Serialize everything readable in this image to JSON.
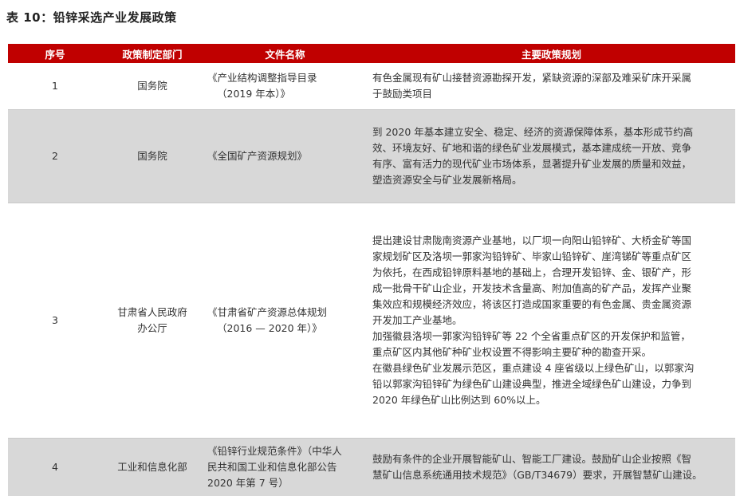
{
  "title": "表 10：铅锌采选产业发展政策",
  "headers": [
    "序号",
    "政策制定部门",
    "文件名称",
    "主要政策规划"
  ],
  "rows": [
    {
      "no": "1",
      "dept": "国务院",
      "doc": [
        "《产业结构调整指导目录",
        "（2019 年本）》"
      ],
      "plan": [
        "有色金属现有矿山接替资源勘探开发，紧缺资源的深部及难采矿床开采属",
        "于鼓励类项目"
      ]
    },
    {
      "no": "2",
      "dept": "国务院",
      "doc": [
        "《全国矿产资源规划》"
      ],
      "plan": [
        "到 2020 年基本建立安全、稳定、经济的资源保障体系，基本形成节约高",
        "效、环境友好、矿地和谐的绿色矿业发展模式，基本建成统一开放、竞争",
        "有序、富有活力的现代矿业市场体系，显著提升矿业发展的质量和效益，",
        "塑造资源安全与矿业发展新格局。"
      ]
    },
    {
      "no": "3",
      "dept": [
        "甘肃省人民政府",
        "办公厅"
      ],
      "doc": [
        "《甘肃省矿产资源总体规划",
        "（2016 — 2020 年）》"
      ],
      "plan": [
        "提出建设甘肃陇南资源产业基地，以厂坝一向阳山铅锌矿、大桥金矿等国",
        "家规划矿区及洛坝一郭家沟铅锌矿、毕家山铅锌矿、崖湾锑矿等重点矿区",
        "为依托，在西成铅锌原料基地的基础上，合理开发铅锌、金、银矿产，形",
        "成一批骨干矿山企业，开发技术含量高、附加值高的矿产品，发挥产业聚",
        "集效应和规模经济效应，将该区打造成国家重要的有色金属、贵金属资源",
        "开发加工产业基地。",
        "加强徽县洛坝一郭家沟铅锌矿等 22 个全省重点矿区的开发保护和监管，",
        "重点矿区内其他矿种矿业权设置不得影响主要矿种的勘查开采。",
        "在徽县绿色矿业发展示范区，重点建设 4 座省级以上绿色矿山，以郭家沟",
        "铅以郭家沟铅锌矿为绿色矿山建设典型，推进全域绿色矿山建设，力争到",
        "2020 年绿色矿山比例达到 60%以上。"
      ]
    },
    {
      "no": "4",
      "dept": "工业和信息化部",
      "doc": [
        "《铅锌行业规范条件》（中华人",
        "民共和国工业和信息化部公告",
        "2020 年第 7 号）"
      ],
      "plan": [
        "鼓励有条件的企业开展智能矿山、智能工厂建设。鼓励矿山企业按照《智",
        "慧矿山信息系统通用技术规范》（GB/T34679）要求，开展智慧矿山建设。"
      ]
    }
  ]
}
